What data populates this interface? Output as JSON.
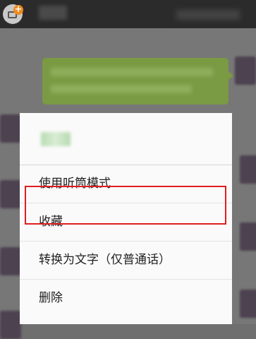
{
  "menu": {
    "items": [
      {
        "label": "使用听筒模式"
      },
      {
        "label": "收藏"
      },
      {
        "label": "转换为文字（仅普通话）"
      },
      {
        "label": "删除"
      }
    ]
  },
  "colors": {
    "top_bar": "#2b2b2b",
    "sent_bubble": "#7a9a43",
    "menu_background": "#fafafa",
    "highlight_border": "#e01e1e",
    "app_icon_badge": "#f08a1e"
  },
  "icons": {
    "app_icon": "app-add-icon"
  }
}
